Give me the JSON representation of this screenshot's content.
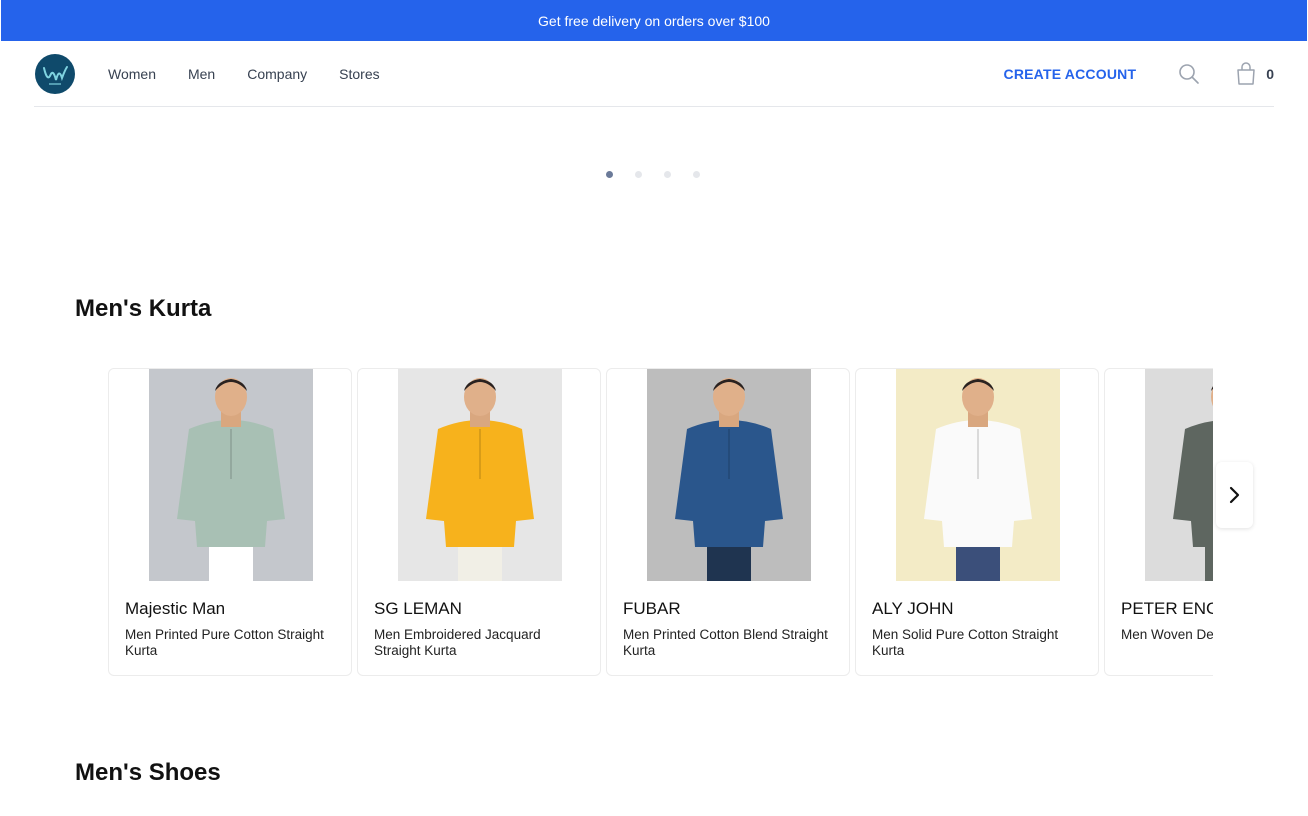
{
  "promo": {
    "text": "Get free delivery on orders over $100"
  },
  "header": {
    "logo_text": "vm",
    "nav": [
      "Women",
      "Men",
      "Company",
      "Stores"
    ],
    "create_account": "CREATE ACCOUNT",
    "cart_count": "0"
  },
  "carousel": {
    "dots": 4,
    "active": 0
  },
  "sections": {
    "kurta_title": "Men's Kurta",
    "shoes_title": "Men's Shoes"
  },
  "products": [
    {
      "brand": "Majestic Man",
      "desc": "Men Printed Pure Cotton Straight Kurta",
      "bg": "#c4c7cc",
      "kurta": "#a8c0b4",
      "pants": "#ffffff"
    },
    {
      "brand": "SG LEMAN",
      "desc": "Men Embroidered Jacquard Straight Kurta",
      "bg": "#e6e6e6",
      "kurta": "#f7b21c",
      "pants": "#f1efe6"
    },
    {
      "brand": "FUBAR",
      "desc": "Men Printed Cotton Blend Straight Kurta",
      "bg": "#bdbdbd",
      "kurta": "#2a568c",
      "pants": "#1f3450"
    },
    {
      "brand": "ALY JOHN",
      "desc": "Men Solid Pure Cotton Straight Kurta",
      "bg": "#f3ebc6",
      "kurta": "#fafafa",
      "pants": "#3b4f7a"
    },
    {
      "brand": "PETER ENGLAND",
      "desc": "Men Woven Design Straight Kurta",
      "bg": "#dcdcdc",
      "kurta": "#5e6660",
      "pants": "#5e6660"
    }
  ],
  "colors": {
    "accent": "#2563eb",
    "logo_bg": "#0f4a6b"
  }
}
